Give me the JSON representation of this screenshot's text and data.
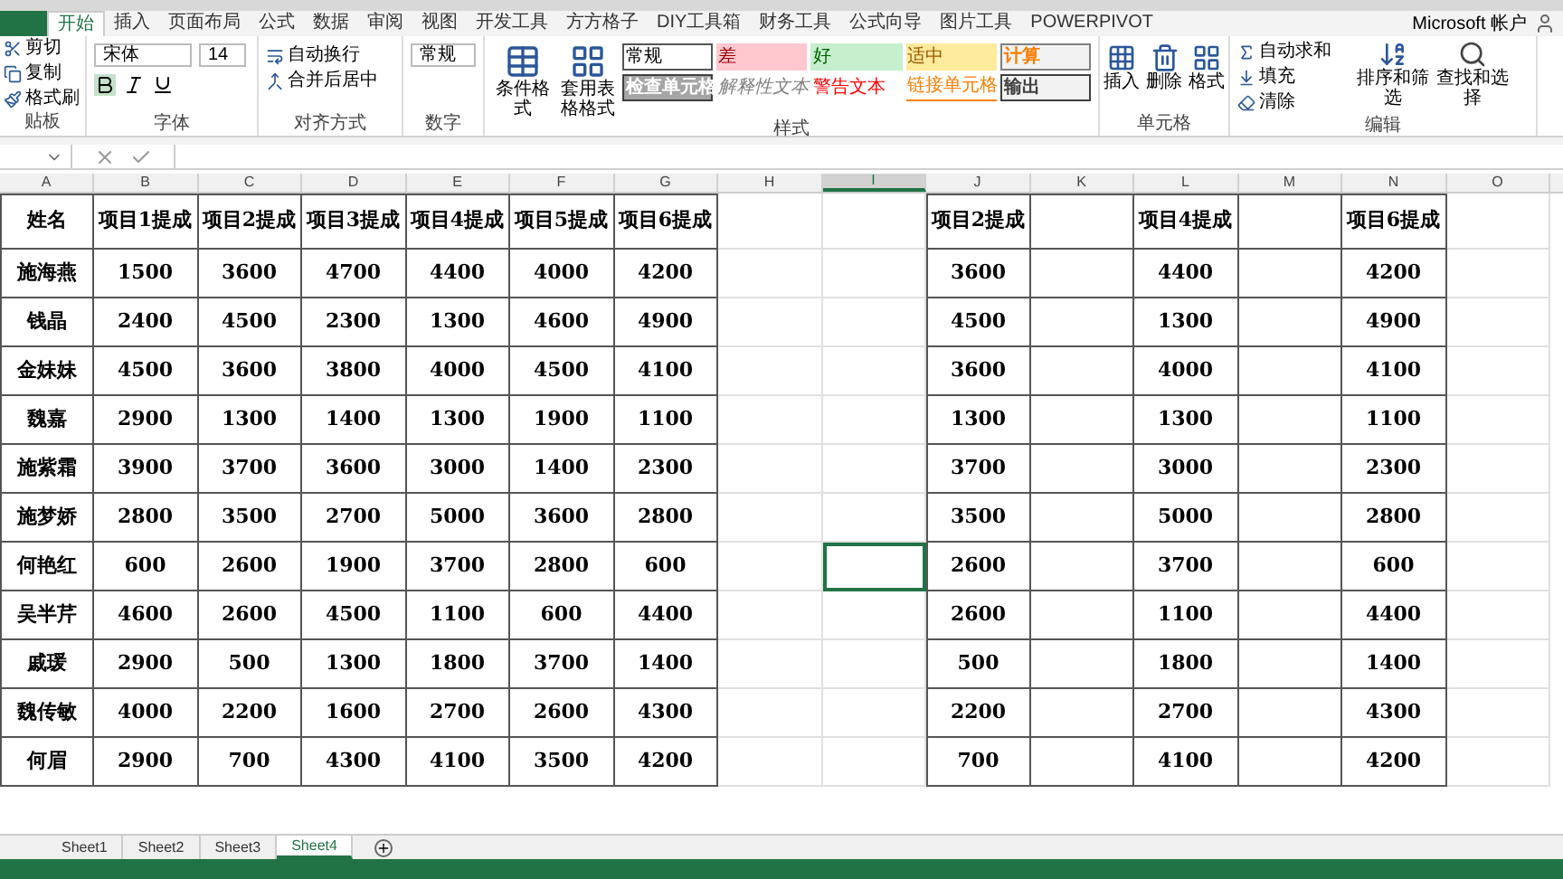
{
  "ribbon_tabs": [
    {
      "label": "开始",
      "selected": true
    },
    {
      "label": "插入",
      "selected": false
    },
    {
      "label": "页面布局",
      "selected": false
    },
    {
      "label": "公式",
      "selected": false
    },
    {
      "label": "数据",
      "selected": false
    },
    {
      "label": "审阅",
      "selected": false
    },
    {
      "label": "视图",
      "selected": false
    },
    {
      "label": "开发工具",
      "selected": false
    },
    {
      "label": "方方格子",
      "selected": false
    },
    {
      "label": "DIY工具箱",
      "selected": false
    },
    {
      "label": "财务工具",
      "selected": false
    },
    {
      "label": "公式向导",
      "selected": false
    },
    {
      "label": "图片工具",
      "selected": false
    },
    {
      "label": "POWERPIVOT",
      "selected": false
    }
  ],
  "account": "Microsoft 帐户",
  "clipboard": {
    "items": [
      "剪切",
      "复制",
      "格式刷"
    ],
    "label": "贴板"
  },
  "font": {
    "name": "宋体",
    "size": "14",
    "label": "字体"
  },
  "alignment": {
    "wrap": "自动换行",
    "merge": "合并后居中",
    "label": "对齐方式"
  },
  "number": {
    "format": "常规",
    "label": "数字"
  },
  "styles": {
    "conditional": "条件格式",
    "table": "套用表格格式",
    "label": "样式",
    "cell_styles": [
      {
        "label": "常规",
        "kind": "normal"
      },
      {
        "label": "差",
        "kind": "bad"
      },
      {
        "label": "好",
        "kind": "good"
      },
      {
        "label": "适中",
        "kind": "neutral"
      },
      {
        "label": "计算",
        "kind": "calc"
      },
      {
        "label": "检查单元格",
        "kind": "check"
      },
      {
        "label": "解释性文本",
        "kind": "explain"
      },
      {
        "label": "警告文本",
        "kind": "warn"
      },
      {
        "label": "链接单元格",
        "kind": "link"
      },
      {
        "label": "输出",
        "kind": "output"
      }
    ]
  },
  "cells_group": {
    "items": [
      "插入",
      "删除",
      "格式"
    ],
    "label": "单元格"
  },
  "editing": {
    "autosum": "自动求和",
    "fill": "填充",
    "clear": "清除",
    "sort": "排序和筛选",
    "find": "查找和选择",
    "label": "编辑"
  },
  "columns": [
    {
      "label": "A",
      "selected": false
    },
    {
      "label": "B",
      "selected": false
    },
    {
      "label": "C",
      "selected": false
    },
    {
      "label": "D",
      "selected": false
    },
    {
      "label": "E",
      "selected": false
    },
    {
      "label": "F",
      "selected": false
    },
    {
      "label": "G",
      "selected": false
    },
    {
      "label": "H",
      "selected": false
    },
    {
      "label": "I",
      "selected": true
    },
    {
      "label": "J",
      "selected": false
    },
    {
      "label": "K",
      "selected": false
    },
    {
      "label": "L",
      "selected": false
    },
    {
      "label": "M",
      "selected": false
    },
    {
      "label": "N",
      "selected": false
    },
    {
      "label": "O",
      "selected": false
    }
  ],
  "headers": [
    "姓名",
    "项目1提成",
    "项目2提成",
    "项目3提成",
    "项目4提成",
    "项目5提成",
    "项目6提成"
  ],
  "copied_headers": [
    "项目2提成",
    "项目4提成",
    "项目6提成"
  ],
  "rows": [
    {
      "name": "施海燕",
      "values": [
        "1500",
        "3600",
        "4700",
        "4400",
        "4000",
        "4200"
      ],
      "copied": [
        "3600",
        "4400",
        "4200"
      ],
      "selected": false
    },
    {
      "name": "钱晶",
      "values": [
        "2400",
        "4500",
        "2300",
        "1300",
        "4600",
        "4900"
      ],
      "copied": [
        "4500",
        "1300",
        "4900"
      ],
      "selected": false
    },
    {
      "name": "金妹妹",
      "values": [
        "4500",
        "3600",
        "3800",
        "4000",
        "4500",
        "4100"
      ],
      "copied": [
        "3600",
        "4000",
        "4100"
      ],
      "selected": false
    },
    {
      "name": "魏嘉",
      "values": [
        "2900",
        "1300",
        "1400",
        "1300",
        "1900",
        "1100"
      ],
      "copied": [
        "1300",
        "1300",
        "1100"
      ],
      "selected": false
    },
    {
      "name": "施紫霜",
      "values": [
        "3900",
        "3700",
        "3600",
        "3000",
        "1400",
        "2300"
      ],
      "copied": [
        "3700",
        "3000",
        "2300"
      ],
      "selected": false
    },
    {
      "name": "施梦娇",
      "values": [
        "2800",
        "3500",
        "2700",
        "5000",
        "3600",
        "2800"
      ],
      "copied": [
        "3500",
        "5000",
        "2800"
      ],
      "selected": false
    },
    {
      "name": "何艳红",
      "values": [
        "600",
        "2600",
        "1900",
        "3700",
        "2800",
        "600"
      ],
      "copied": [
        "2600",
        "3700",
        "600"
      ],
      "selected": true
    },
    {
      "name": "吴半芹",
      "values": [
        "4600",
        "2600",
        "4500",
        "1100",
        "600",
        "4400"
      ],
      "copied": [
        "2600",
        "1100",
        "4400"
      ],
      "selected": false
    },
    {
      "name": "戚瑗",
      "values": [
        "2900",
        "500",
        "1300",
        "1800",
        "3700",
        "1400"
      ],
      "copied": [
        "500",
        "1800",
        "1400"
      ],
      "selected": false
    },
    {
      "name": "魏传敏",
      "values": [
        "4000",
        "2200",
        "1600",
        "2700",
        "2600",
        "4300"
      ],
      "copied": [
        "2200",
        "2700",
        "4300"
      ],
      "selected": false
    },
    {
      "name": "何眉",
      "values": [
        "2900",
        "700",
        "4300",
        "4100",
        "3500",
        "4200"
      ],
      "copied": [
        "700",
        "4100",
        "4200"
      ],
      "selected": false
    }
  ],
  "sheet_tabs": [
    {
      "label": "Sheet1",
      "selected": false
    },
    {
      "label": "Sheet2",
      "selected": false
    },
    {
      "label": "Sheet3",
      "selected": false
    },
    {
      "label": "Sheet4",
      "selected": true
    }
  ]
}
